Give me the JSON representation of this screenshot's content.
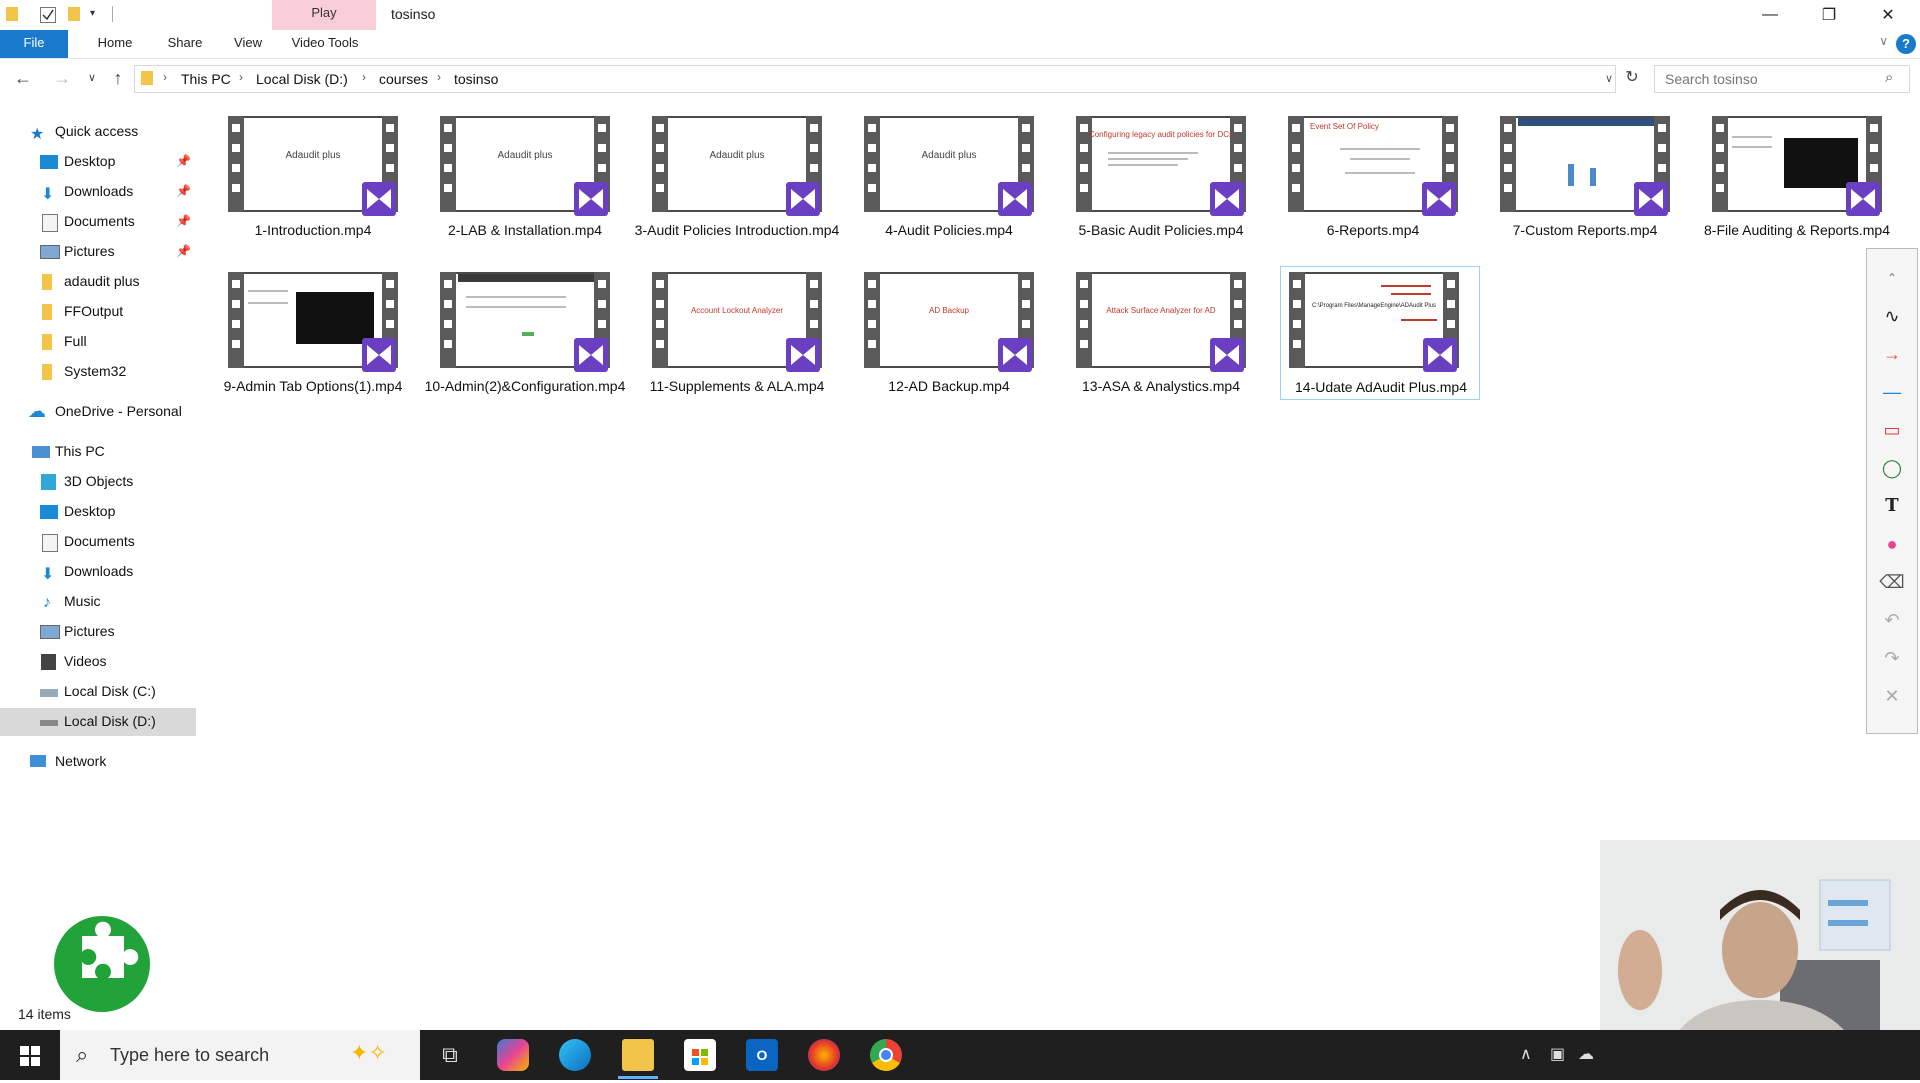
{
  "titlebar": {
    "context_tab": "Play",
    "window_title": "tosinso",
    "minimize": "—",
    "maximize": "❐",
    "close": "✕"
  },
  "ribbon": {
    "tabs": [
      "File",
      "Home",
      "Share",
      "View",
      "Video Tools"
    ],
    "help": "?"
  },
  "address": {
    "crumbs": [
      "This PC",
      "Local Disk (D:)",
      "courses",
      "tosinso"
    ],
    "search_placeholder": "Search tosinso"
  },
  "sidebar": {
    "quick_access": "Quick access",
    "quick_items": [
      "Desktop",
      "Downloads",
      "Documents",
      "Pictures",
      "adaudit plus",
      "FFOutput",
      "Full",
      "System32"
    ],
    "onedrive": "OneDrive - Personal",
    "this_pc": "This PC",
    "pc_items": [
      "3D Objects",
      "Desktop",
      "Documents",
      "Downloads",
      "Music",
      "Pictures",
      "Videos",
      "Local Disk (C:)",
      "Local Disk (D:)"
    ],
    "network": "Network"
  },
  "files": [
    {
      "name": "1-Introduction.mp4",
      "thumb": "Adaudit plus"
    },
    {
      "name": "2-LAB & Installation.mp4",
      "thumb": "Adaudit plus"
    },
    {
      "name": "3-Audit Policies Introduction.mp4",
      "thumb": "Adaudit plus"
    },
    {
      "name": "4-Audit Policies.mp4",
      "thumb": "Adaudit plus"
    },
    {
      "name": "5-Basic Audit Policies.mp4",
      "thumb": "Configuring legacy audit policies for DCs"
    },
    {
      "name": "6-Reports.mp4",
      "thumb": "Event Set Of Policy"
    },
    {
      "name": "7-Custom Reports.mp4",
      "thumb": ""
    },
    {
      "name": "8-File Auditing & Reports.mp4",
      "thumb": ""
    },
    {
      "name": "9-Admin Tab Options(1).mp4",
      "thumb": ""
    },
    {
      "name": "10-Admin(2)&Configuration.mp4",
      "thumb": ""
    },
    {
      "name": "11-Supplements & ALA.mp4",
      "thumb": "Account Lockout Analyzer"
    },
    {
      "name": "12-AD Backup.mp4",
      "thumb": "AD Backup"
    },
    {
      "name": "13-ASA & Analystics.mp4",
      "thumb": "Attack Surface Analyzer for AD"
    },
    {
      "name": "14-Udate AdAudit Plus.mp4",
      "thumb": "C:\\Program Files\\ManageEngine\\ADAudit Plus"
    }
  ],
  "status": {
    "count": "14 items"
  },
  "taskbar": {
    "search_text": "Type here to search"
  },
  "colors": {
    "accent": "#1979ca",
    "play_tab": "#f9cdd8",
    "badge": "#6a3fc1",
    "taskbar": "#1f1f1f"
  }
}
